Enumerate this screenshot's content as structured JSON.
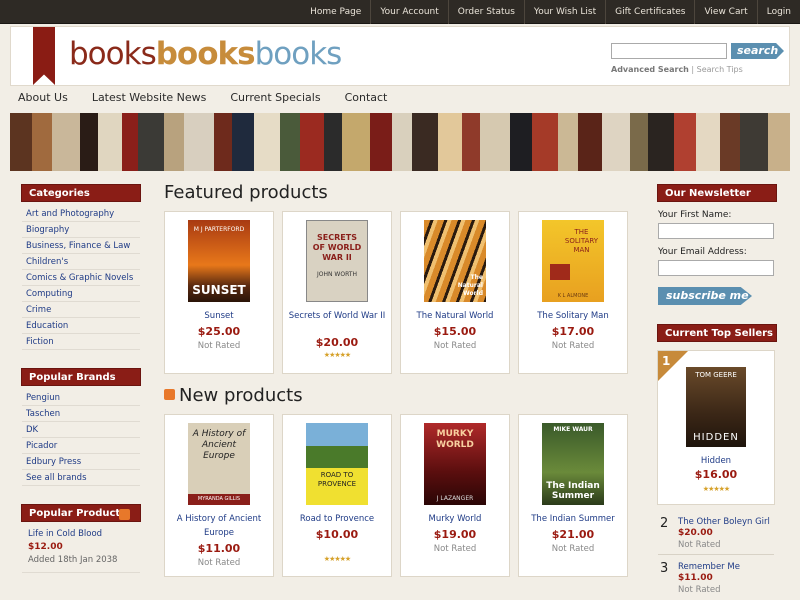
{
  "topnav": [
    "Home Page",
    "Your Account",
    "Order Status",
    "Your Wish List",
    "Gift Certificates",
    "View Cart",
    "Login"
  ],
  "logo": {
    "a": "books",
    "b": "books",
    "c": "books"
  },
  "search": {
    "button": "search",
    "advanced": "Advanced Search",
    "tips": "Search Tips",
    "sep": " | "
  },
  "mainnav": [
    "About Us",
    "Latest Website News",
    "Current Specials",
    "Contact"
  ],
  "categories": {
    "title": "Categories",
    "items": [
      "Art and Photography",
      "Biography",
      "Business, Finance & Law",
      "Children's",
      "Comics & Graphic Novels",
      "Computing",
      "Crime",
      "Education",
      "Fiction"
    ]
  },
  "brands": {
    "title": "Popular Brands",
    "items": [
      "Pengiun",
      "Taschen",
      "DK",
      "Picador",
      "Edbury Press",
      "See all brands"
    ]
  },
  "popular": {
    "title": "Popular Products",
    "item": "Life in Cold Blood",
    "price": "$12.00",
    "added": "Added 18th Jan 2038"
  },
  "featured": {
    "title": "Featured products",
    "products": [
      {
        "title": "Sunset",
        "price": "$25.00",
        "rating": "Not Rated",
        "cover_top": "M J PARTERFORD",
        "cover_main": "SUNSET"
      },
      {
        "title": "Secrets of World War II",
        "price": "$20.00",
        "rating": "",
        "cover_top": "SECRETS OF WORLD WAR II",
        "cover_main": "JOHN WORTH"
      },
      {
        "title": "The Natural World",
        "price": "$15.00",
        "rating": "Not Rated",
        "cover_top": "",
        "cover_main": "The Natural World"
      },
      {
        "title": "The Solitary Man",
        "price": "$17.00",
        "rating": "Not Rated",
        "cover_top": "THE SOLITARY MAN",
        "cover_main": "K L ALMONE"
      }
    ]
  },
  "newproducts": {
    "title": "New products",
    "products": [
      {
        "title": "A History of Ancient Europe",
        "price": "$11.00",
        "rating": "Not Rated",
        "cover_top": "A History of Ancient Europe",
        "cover_main": "MYRANDA GILLIS"
      },
      {
        "title": "Road to Provence",
        "price": "$10.00",
        "rating": "",
        "cover_top": "",
        "cover_main": "ROAD TO PROVENCE"
      },
      {
        "title": "Murky World",
        "price": "$19.00",
        "rating": "Not Rated",
        "cover_top": "MURKY WORLD",
        "cover_main": "J LAZANGER"
      },
      {
        "title": "The Indian Summer",
        "price": "$21.00",
        "rating": "Not Rated",
        "cover_top": "MIKE WAUR",
        "cover_main": "The Indian Summer"
      }
    ]
  },
  "newsletter": {
    "title": "Our Newsletter",
    "first_name": "Your First Name:",
    "email": "Your Email Address:",
    "button": "subscribe me"
  },
  "topsellers": {
    "title": "Current Top Sellers",
    "first": {
      "rank": "1",
      "title": "Hidden",
      "price": "$16.00",
      "cover_top": "TOM GEERE",
      "cover_main": "HIDDEN"
    },
    "others": [
      {
        "rank": "2",
        "title": "The Other Boleyn Girl",
        "price": "$20.00",
        "rating": "Not Rated"
      },
      {
        "rank": "3",
        "title": "Remember Me",
        "price": "$11.00",
        "rating": "Not Rated"
      }
    ]
  },
  "colors": {
    "accent_red": "#8a1d16",
    "link_blue": "#1f3b86",
    "price_red": "#9a1a10",
    "button_blue": "#5b8fb0",
    "star_gold": "#d6a12a"
  }
}
